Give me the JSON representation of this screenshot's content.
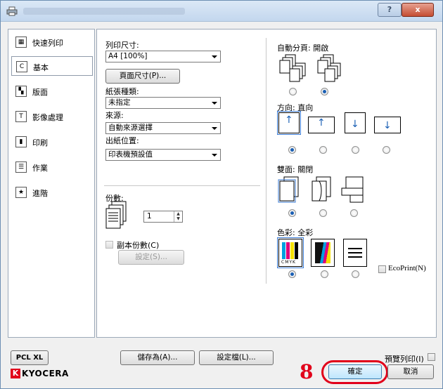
{
  "window": {
    "title_hidden": true,
    "help": "?",
    "close": "x"
  },
  "sidebar": {
    "items": [
      {
        "label": "快速列印",
        "icon": "quick-print-icon"
      },
      {
        "label": "基本",
        "icon": "basic-icon"
      },
      {
        "label": "版面",
        "icon": "layout-icon"
      },
      {
        "label": "影像處理",
        "icon": "imaging-icon"
      },
      {
        "label": "印刷",
        "icon": "publishing-icon"
      },
      {
        "label": "作業",
        "icon": "job-icon"
      },
      {
        "label": "進階",
        "icon": "advanced-icon"
      }
    ],
    "selected": 1
  },
  "basic": {
    "print_size_label": "列印尺寸:",
    "print_size_value": "A4 [100%]",
    "page_size_button": "頁面尺寸(P)...",
    "media_type_label": "紙張種類:",
    "media_type_value": "未指定",
    "source_label": "來源:",
    "source_value": "自動來源選擇",
    "destination_label": "出紙位置:",
    "destination_value": "印表機預設值",
    "copies_label": "份數:",
    "copies_value": "1",
    "copy_count_label": "副本份數(C)",
    "settings_button": "設定(S)..."
  },
  "right": {
    "collate_label": "自動分頁: 開啟",
    "orientation_label": "方向: 直向",
    "duplex_label": "雙面: 關閉",
    "color_label": "色彩: 全彩",
    "ecoprint_label": "EcoPrint(N)",
    "cmyk_text": "CMYK"
  },
  "footer": {
    "pcl_button": "PCL XL",
    "save_as_button": "儲存為(A)...",
    "profile_button": "設定檔(L)...",
    "preview_label": "預覽列印(I)",
    "brand": "KYOCERA",
    "ok_button": "確定",
    "cancel_button": "取消",
    "step_number": "8"
  },
  "colors": {
    "accent": "#e1001a",
    "selection": "#1a5fb4"
  }
}
